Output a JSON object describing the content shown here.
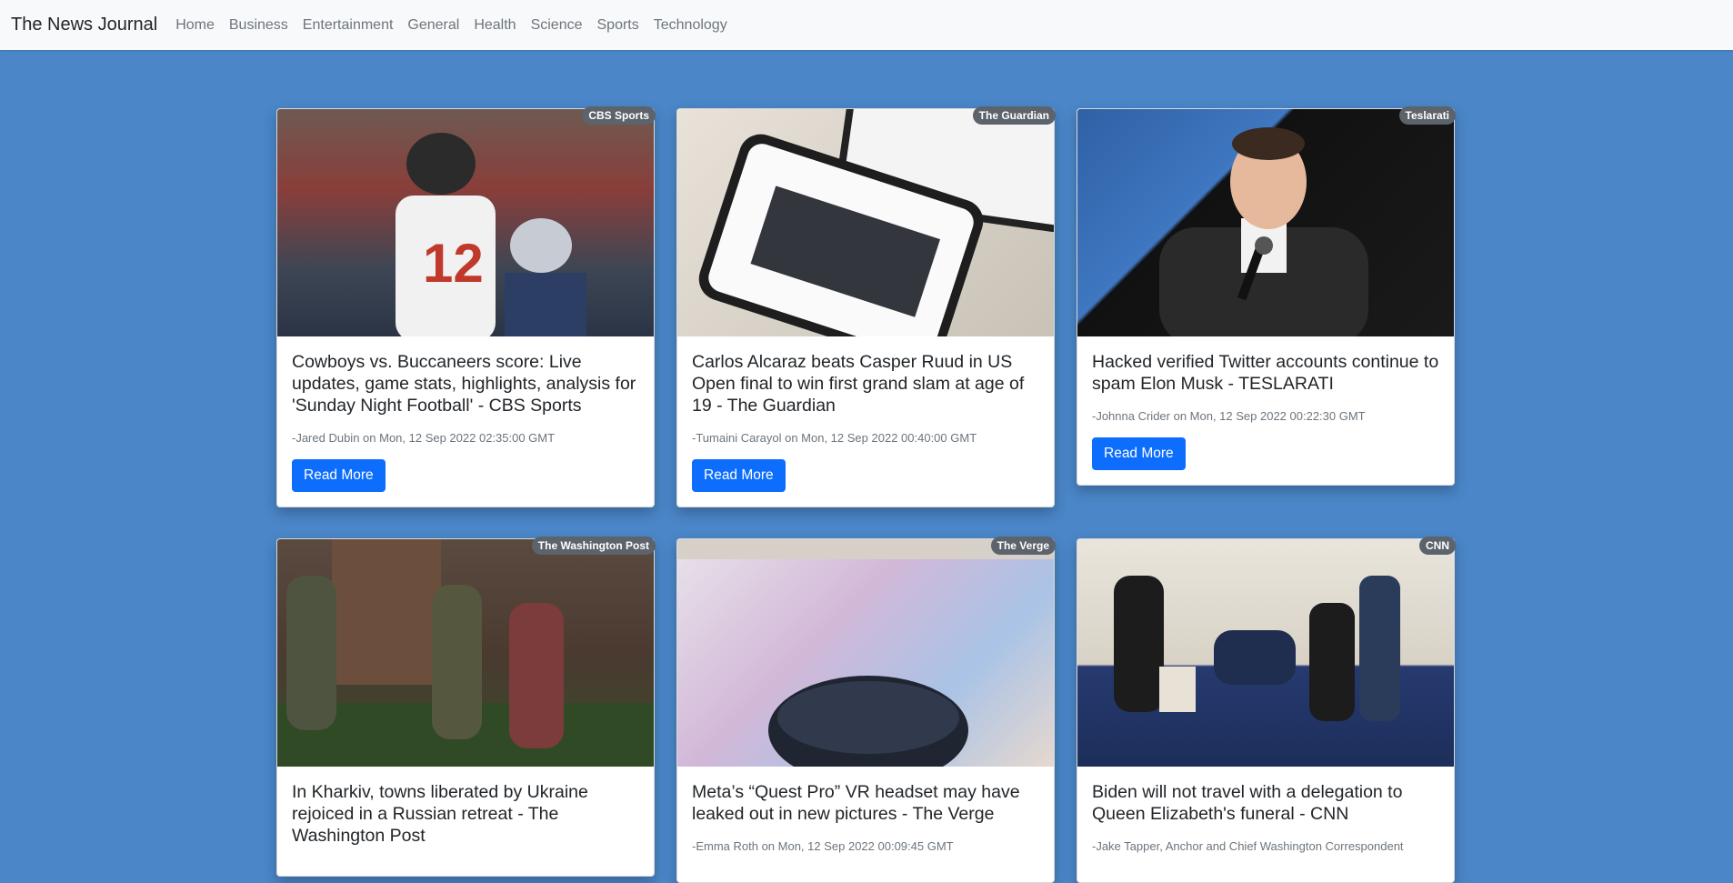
{
  "nav": {
    "brand": "The News Journal",
    "links": [
      "Home",
      "Business",
      "Entertainment",
      "General",
      "Health",
      "Science",
      "Sports",
      "Technology"
    ]
  },
  "cards": [
    {
      "source": "CBS Sports",
      "title": "Cowboys vs. Buccaneers score: Live updates, game stats, highlights, analysis for 'Sunday Night Football' - CBS Sports",
      "meta": "-Jared Dubin on Mon, 12 Sep 2022 02:35:00 GMT",
      "button": "Read More",
      "image": "football-quarterback-photo"
    },
    {
      "source": "The Guardian",
      "title": "Carlos Alcaraz beats Casper Ruud in US Open final to win first grand slam at age of 19 - The Guardian",
      "meta": "-Tumaini Carayol on Mon, 12 Sep 2022 00:40:00 GMT",
      "button": "Read More",
      "image": "phone-news-app-photo"
    },
    {
      "source": "Teslarati",
      "title": "Hacked verified Twitter accounts continue to spam Elon Musk - TESLARATI",
      "meta": "-Johnna Crider on Mon, 12 Sep 2022 00:22:30 GMT",
      "button": "Read More",
      "image": "speaker-microphone-photo"
    },
    {
      "source": "The Washington Post",
      "title": "In Kharkiv, towns liberated by Ukraine rejoiced in a Russian retreat - The Washington Post",
      "meta": "",
      "button": "",
      "image": "soldiers-ruins-photo"
    },
    {
      "source": "The Verge",
      "title": "Meta’s “Quest Pro” VR headset may have leaked out in new pictures - The Verge",
      "meta": "-Emma Roth on Mon, 12 Sep 2022 00:09:45 GMT",
      "button": "",
      "image": "vr-headset-photo"
    },
    {
      "source": "CNN",
      "title": "Biden will not travel with a delegation to Queen Elizabeth's funeral - CNN",
      "meta": "-Jake Tapper, Anchor and Chief Washington Correspondent",
      "button": "",
      "image": "condolence-book-photo"
    }
  ]
}
